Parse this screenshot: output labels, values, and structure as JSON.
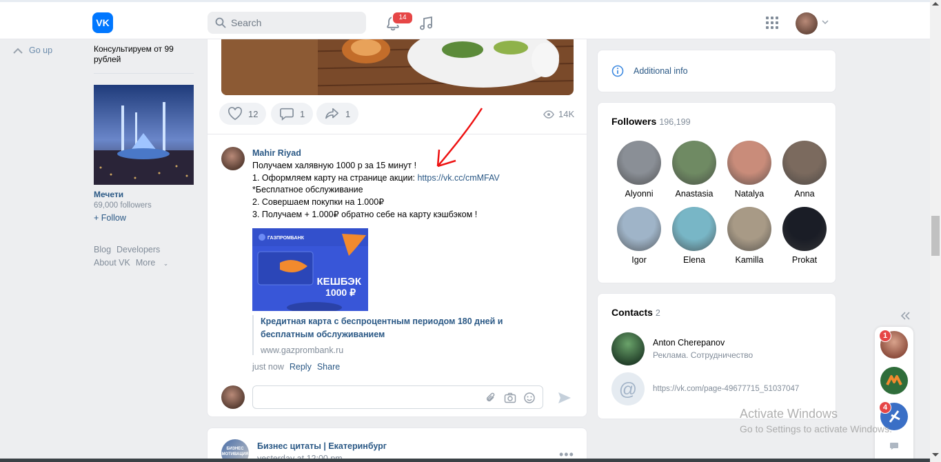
{
  "header": {
    "search_placeholder": "Search",
    "notifications_count": "14"
  },
  "left": {
    "go_up": "Go up",
    "ad_text": "Консультируем от 99 рублей",
    "group_name": "Мечети",
    "group_followers": "69,000 followers",
    "follow_label": "+ Follow",
    "links": [
      "Blog",
      "Developers",
      "About VK",
      "More"
    ]
  },
  "post1": {
    "likes": "12",
    "comments": "1",
    "shares": "1",
    "views": "14K"
  },
  "comment": {
    "author": "Mahir Riyad",
    "line1": "Получаем халявную 1000 р за 15 минут !",
    "line2_prefix": "1. Оформляем карту на странице акции: ",
    "line2_link": "https://vk.cc/cmMFAV",
    "line3": "*Бесплатное обслуживание",
    "line4": "2. Совершаем покупки на 1.000₽",
    "line5": "3. Получаем + 1.000₽ обратно себе на карту кэшбэком !",
    "image": {
      "bank": "ГАЗПРОМБАНК",
      "headline": "КЕШБЭК",
      "amount": "1000 ₽"
    },
    "snippet_title": "Кредитная карта с беспроцентным периодом 180 дней и бесплатным обслуживанием",
    "snippet_url": "www.gazprombank.ru",
    "time": "just now",
    "reply": "Reply",
    "share": "Share"
  },
  "post3": {
    "author": "Бизнес цитаты | Екатеринбург",
    "time": "yesterday at 12:00 pm",
    "avatar_text": "БИЗНЕС МОТИВАЦИЯ"
  },
  "right": {
    "additional_info": "Additional info",
    "followers_title": "Followers",
    "followers_count": "196,199",
    "followers": [
      {
        "name": "Alyonni",
        "color": "#8a8f96"
      },
      {
        "name": "Anastasia",
        "color": "#6f8a63"
      },
      {
        "name": "Natalya",
        "color": "#c98c7a"
      },
      {
        "name": "Anna",
        "color": "#7b6a5e"
      },
      {
        "name": "Igor",
        "color": "#9fb4c8"
      },
      {
        "name": "Elena",
        "color": "#78b6c6"
      },
      {
        "name": "Kamilla",
        "color": "#a89a86"
      },
      {
        "name": "Prokat",
        "color": "#1a1d26"
      }
    ],
    "contacts_title": "Contacts",
    "contacts_count": "2",
    "contact_name": "Anton Cherepanov",
    "contact_role": "Реклама. Сотрудничество",
    "contact_link": "https://vk.com/page-49677715_51037047"
  },
  "chats": {
    "badge1": "1",
    "badge2": "4"
  },
  "windows": {
    "title": "Activate Windows",
    "subtitle": "Go to Settings to activate Windows."
  }
}
